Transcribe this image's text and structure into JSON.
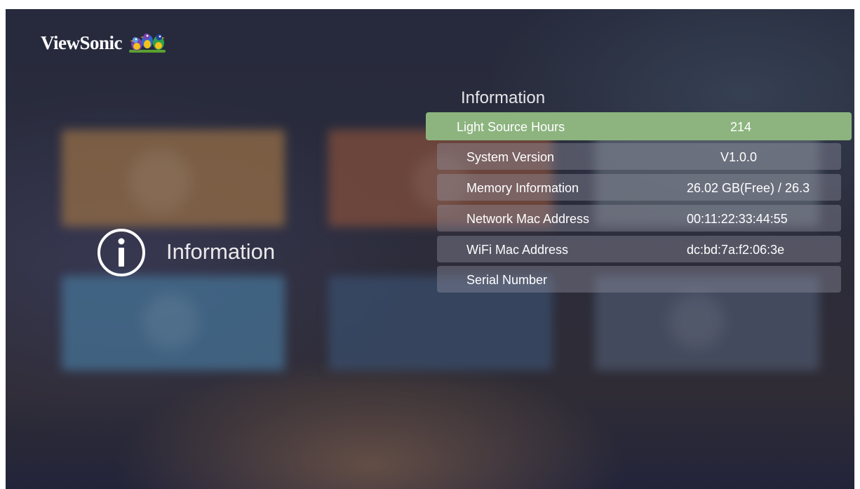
{
  "brand": {
    "name": "ViewSonic",
    "icon": "viewsonic-birds-logo"
  },
  "side": {
    "icon": "info-circle-icon",
    "title": "Information"
  },
  "panel": {
    "title": "Information",
    "rows": [
      {
        "label": "Light Source Hours",
        "value": "214",
        "selected": true
      },
      {
        "label": "System Version",
        "value": "V1.0.0"
      },
      {
        "label": "Memory Information",
        "value": "26.02 GB(Free) / 26.3"
      },
      {
        "label": "Network Mac Address",
        "value": "00:11:22:33:44:55"
      },
      {
        "label": "WiFi Mac Address",
        "value": "dc:bd:7a:f2:06:3e"
      },
      {
        "label": "Serial Number",
        "value": ""
      }
    ]
  },
  "colors": {
    "selected_row": "#8db47f",
    "row_bg": "#6b6b78",
    "text": "#ffffff"
  }
}
